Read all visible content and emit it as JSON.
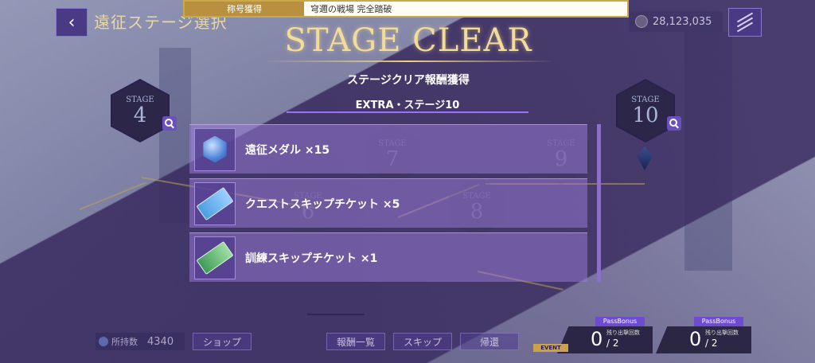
{
  "header": {
    "back_icon": "chevron-left-icon",
    "title": "遠征ステージ選択",
    "coins": "28,123,035",
    "menu_icon": "menu-icon"
  },
  "banner": {
    "label": "称号獲得",
    "value": "穹邇の戦場 完全踏破"
  },
  "result": {
    "title": "STAGE CLEAR",
    "subtitle": "ステージクリア報酬獲得",
    "stage_name": "EXTRA・ステージ10"
  },
  "stage_map": {
    "stage_label": "STAGE",
    "nodes": [
      {
        "num": "4"
      },
      {
        "num": "7"
      },
      {
        "num": "8"
      },
      {
        "num": "9"
      },
      {
        "num": "10"
      },
      {
        "num": "6"
      }
    ]
  },
  "rewards": [
    {
      "name": "遠征メダル ×15",
      "icon": "medal-icon"
    },
    {
      "name": "クエストスキップチケット ×5",
      "icon": "blue-ticket-icon"
    },
    {
      "name": "訓練スキップチケット ×1",
      "icon": "green-ticket-icon"
    }
  ],
  "bottom": {
    "owned_label": "所持数",
    "owned_value": "4340",
    "shop": "ショップ",
    "reward_list": "報酬一覧",
    "skip": "スキップ",
    "return": "帰還",
    "bonus_tag": "PassBonus",
    "bonus_remaining_label": "残り出撃回数",
    "bonus1_value": "0",
    "bonus1_total": "/ 2",
    "bonus2_value": "0",
    "bonus2_total": "/ 2",
    "event_tag": "EVENT"
  },
  "colors": {
    "accent": "#9a70ff",
    "gold": "#f2dc9a",
    "panel": "#2c2748"
  }
}
